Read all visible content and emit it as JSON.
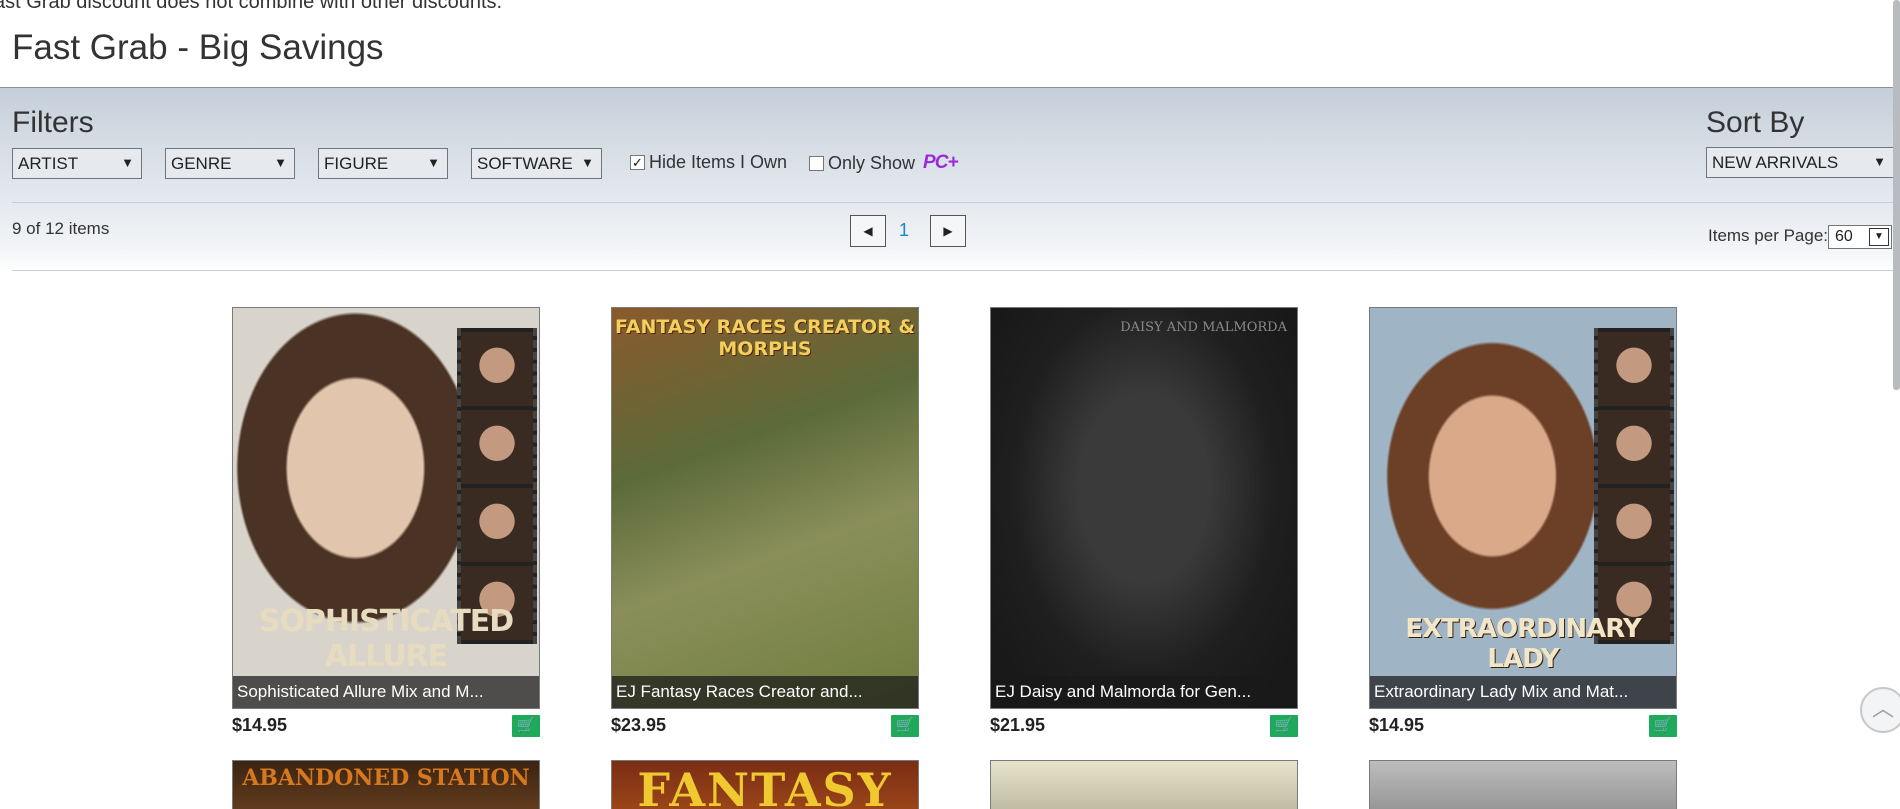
{
  "top_note": "ast Grab discount does not combine with other discounts.",
  "page_title": "Fast Grab - Big Savings",
  "filters": {
    "heading": "Filters",
    "dropdowns": [
      {
        "label": "ARTIST"
      },
      {
        "label": "GENRE"
      },
      {
        "label": "FIGURE"
      },
      {
        "label": "SOFTWARE"
      }
    ],
    "hide_owned": {
      "label": "Hide Items I Own",
      "checked": true
    },
    "only_show": {
      "label": "Only Show",
      "checked": false,
      "badge": "PC+"
    }
  },
  "sort": {
    "heading": "Sort By",
    "selected": "NEW ARRIVALS"
  },
  "pagination": {
    "count_text": "9 of 12 items",
    "current_page": "1",
    "prev_icon": "triangle-left",
    "next_icon": "triangle-right",
    "items_per_page_label": "Items per Page:",
    "items_per_page_value": "60"
  },
  "products": [
    {
      "caption": "Sophisticated Allure Mix and M...",
      "price": "$14.95",
      "overlay": "SOPHISTICATED ALLURE"
    },
    {
      "caption": "EJ Fantasy Races Creator and...",
      "price": "$23.95",
      "overlay": "FANTASY RACES CREATOR & MORPHS"
    },
    {
      "caption": "EJ Daisy and Malmorda for Gen...",
      "price": "$21.95",
      "overlay": "DAISY AND MALMORDA"
    },
    {
      "caption": "Extraordinary Lady Mix and Mat...",
      "price": "$14.95",
      "overlay": "EXTRAORDINARY LADY"
    }
  ],
  "row2_overlays": [
    "ABANDONED STATION",
    "FANTASY",
    "",
    ""
  ],
  "colors": {
    "accent_link": "#1a86c8",
    "cart_green": "#1fa95b",
    "pc_plus_purple": "#9a2bd6"
  }
}
